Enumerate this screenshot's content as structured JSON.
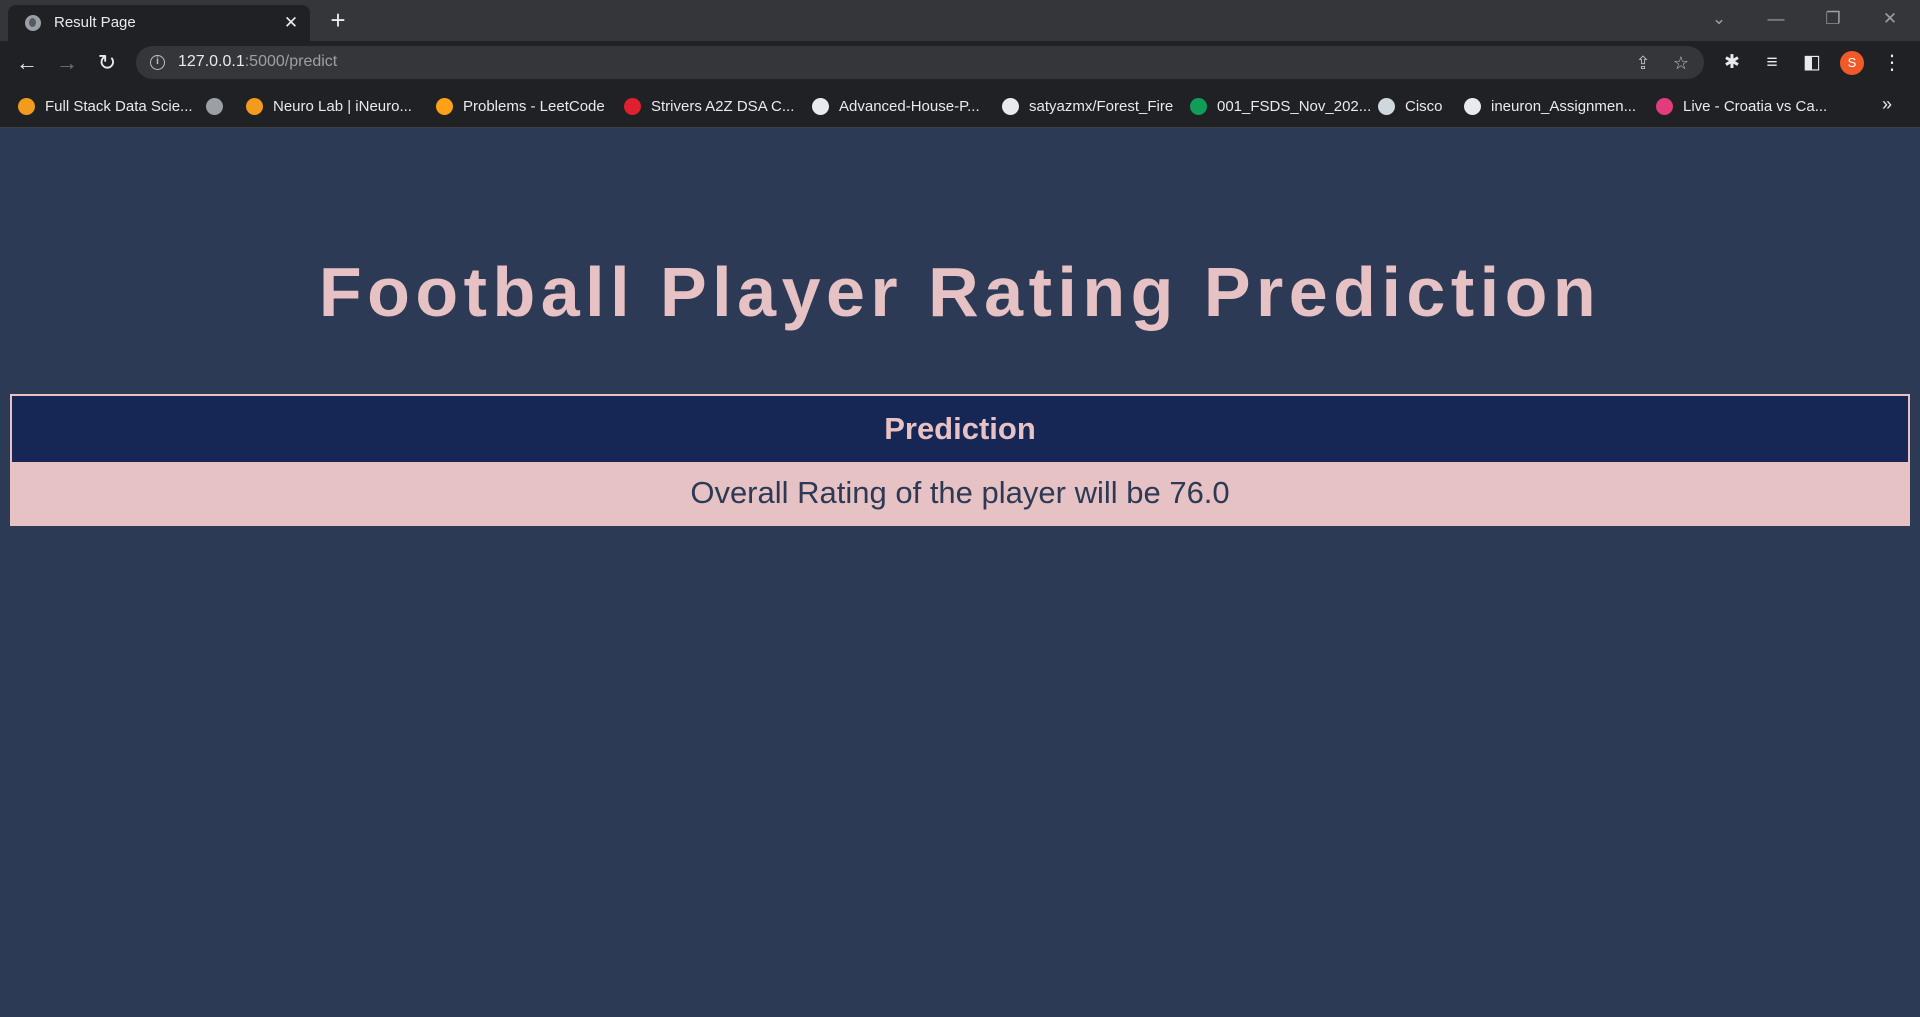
{
  "browser": {
    "tab_title": "Result Page",
    "tab_close": "✕",
    "new_tab": "+",
    "url_host": "127.0.0.1",
    "url_path": ":5000/predict",
    "profile_initial": "S",
    "bookmarks": [
      {
        "label": "Full Stack Data Scie...",
        "icon": "ineuron-icon",
        "color": "#f29b1d"
      },
      {
        "label": "",
        "icon": "globe-icon",
        "color": "#9aa0a6"
      },
      {
        "label": "Neuro Lab | iNeuro...",
        "icon": "ineuron-icon",
        "color": "#f29b1d"
      },
      {
        "label": "Problems - LeetCode",
        "icon": "leetcode-icon",
        "color": "#ffa116"
      },
      {
        "label": "Strivers A2Z DSA C...",
        "icon": "tuf-icon",
        "color": "#e0202e"
      },
      {
        "label": "Advanced-House-P...",
        "icon": "github-icon",
        "color": "#e8eaed"
      },
      {
        "label": "satyazmx/Forest_Fire",
        "icon": "github-icon",
        "color": "#e8eaed"
      },
      {
        "label": "001_FSDS_Nov_202...",
        "icon": "sheets-icon",
        "color": "#0f9d58"
      },
      {
        "label": "Cisco",
        "icon": "cisco-icon",
        "color": "#cfd8dc"
      },
      {
        "label": "ineuron_Assignmen...",
        "icon": "github-icon",
        "color": "#e8eaed"
      },
      {
        "label": "Live - Croatia vs Ca...",
        "icon": "live-icon",
        "color": "#e23c7c"
      }
    ],
    "bookmarks_overflow": "»"
  },
  "page": {
    "title": "Football Player Rating Prediction",
    "table_header": "Prediction",
    "result_text": "Overall Rating of the player will be 76.0"
  },
  "colors": {
    "page_bg": "#2d3a55",
    "accent_pink": "#e7c2c4",
    "header_navy": "#162655"
  }
}
